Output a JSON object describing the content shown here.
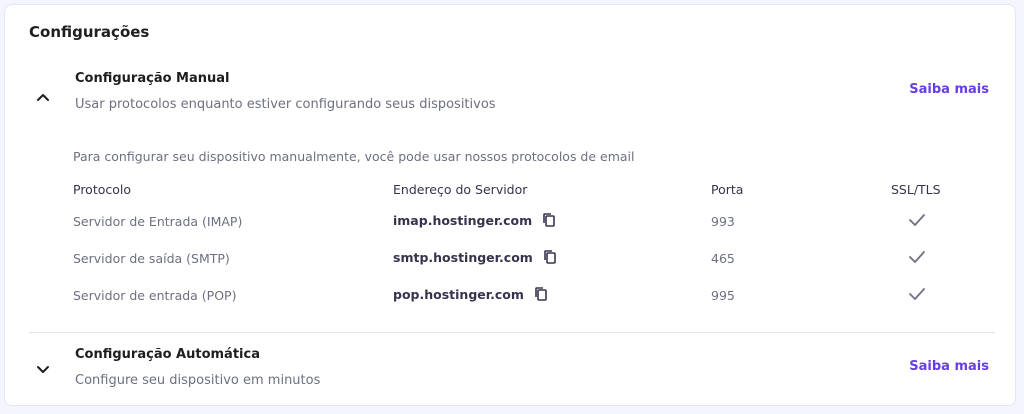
{
  "page": {
    "title": "Configurações"
  },
  "manual": {
    "title": "Configuração Manual",
    "subtitle": "Usar protocolos enquanto estiver configurando seus dispositivos",
    "learn_more": "Saiba mais",
    "toggle_icon": "chevron-up-icon",
    "expanded": true,
    "intro": "Para configurar seu dispositivo manualmente, você pode usar nossos protocolos de email",
    "columns": {
      "protocol": "Protocolo",
      "server": "Endereço do Servidor",
      "port": "Porta",
      "ssl": "SSL/TLS"
    },
    "rows": [
      {
        "protocol": "Servidor de Entrada (IMAP)",
        "server": "imap.hostinger.com",
        "port": "993",
        "ssl": true
      },
      {
        "protocol": "Servidor de saída (SMTP)",
        "server": "smtp.hostinger.com",
        "port": "465",
        "ssl": true
      },
      {
        "protocol": "Servidor de entrada (POP)",
        "server": "pop.hostinger.com",
        "port": "995",
        "ssl": true
      }
    ]
  },
  "automatic": {
    "title": "Configuração Automática",
    "subtitle": "Configure seu dispositivo em minutos",
    "learn_more": "Saiba mais",
    "toggle_icon": "chevron-down-icon",
    "expanded": false
  },
  "colors": {
    "accent": "#673de6",
    "heading": "#1d1e20",
    "muted": "#6d7081",
    "check": "#6d7081"
  }
}
